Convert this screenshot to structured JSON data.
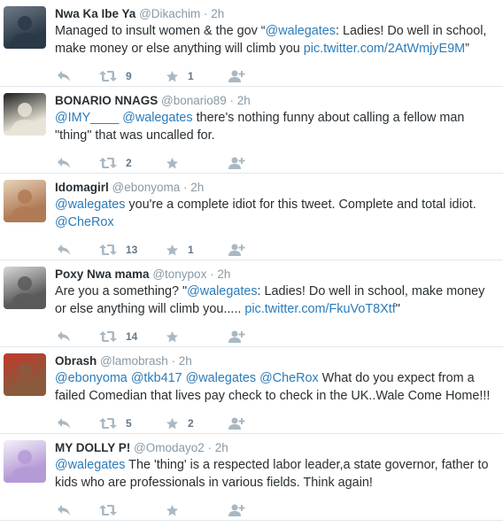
{
  "tweets": [
    {
      "fullname": "Nwa Ka Ibe Ya",
      "username": "@Dikachim",
      "time": "2h",
      "text": [
        {
          "t": "Managed to insult women & the gov “",
          "k": "p"
        },
        {
          "t": "@walegates",
          "k": "m"
        },
        {
          "t": ": Ladies! Do well in school, make money or else anything will climb you ",
          "k": "p"
        },
        {
          "t": "pic.twitter.com/2AtWmjyE9M",
          "k": "l"
        },
        {
          "t": "”",
          "k": "p"
        }
      ],
      "retweets": "9",
      "favorites": "1",
      "avatar_colors": [
        "#2b3a48",
        "#6d7a85"
      ]
    },
    {
      "fullname": "BONARIO NNAGS",
      "username": "@bonario89",
      "time": "2h",
      "text": [
        {
          "t": "@IMY____",
          "k": "m"
        },
        {
          "t": " ",
          "k": "p"
        },
        {
          "t": "@walegates",
          "k": "m"
        },
        {
          "t": " there's nothing funny about calling a fellow man \"thing\" that was uncalled for.",
          "k": "p"
        }
      ],
      "retweets": "2",
      "favorites": "",
      "avatar_colors": [
        "#e9e4d8",
        "#1c1c1c"
      ]
    },
    {
      "fullname": "Idomagirl",
      "username": "@ebonyoma",
      "time": "2h",
      "text": [
        {
          "t": "@walegates",
          "k": "m"
        },
        {
          "t": " you're a complete idiot for this tweet. Complete and total idiot. ",
          "k": "p"
        },
        {
          "t": "@CheRox",
          "k": "m"
        }
      ],
      "retweets": "13",
      "favorites": "1",
      "avatar_colors": [
        "#b07a56",
        "#e6d2b8"
      ]
    },
    {
      "fullname": "Poxy Nwa mama",
      "username": "@tonypox",
      "time": "2h",
      "text": [
        {
          "t": "Are you a something? \"",
          "k": "p"
        },
        {
          "t": "@walegates",
          "k": "m"
        },
        {
          "t": ": Ladies! Do well in school, make money or else anything will climb you..... ",
          "k": "p"
        },
        {
          "t": "pic.twitter.com/FkuVoT8Xtf",
          "k": "l"
        },
        {
          "t": "\"",
          "k": "p"
        }
      ],
      "retweets": "14",
      "favorites": "",
      "avatar_colors": [
        "#5a5a5a",
        "#d8d8d8"
      ]
    },
    {
      "fullname": "Obrash",
      "username": "@lamobrash",
      "time": "2h",
      "text": [
        {
          "t": "@ebonyoma",
          "k": "m"
        },
        {
          "t": " ",
          "k": "p"
        },
        {
          "t": "@tkb417",
          "k": "m"
        },
        {
          "t": " ",
          "k": "p"
        },
        {
          "t": "@walegates",
          "k": "m"
        },
        {
          "t": " ",
          "k": "p"
        },
        {
          "t": "@CheRox",
          "k": "m"
        },
        {
          "t": "  What do you expect from a failed Comedian that lives pay check to check in the UK..Wale Come Home!!!",
          "k": "p"
        }
      ],
      "retweets": "5",
      "favorites": "2",
      "avatar_colors": [
        "#8a5a3c",
        "#c0392b"
      ]
    },
    {
      "fullname": "MY DOLLY P!",
      "username": "@Omodayo2",
      "time": "2h",
      "text": [
        {
          "t": "@walegates",
          "k": "m"
        },
        {
          "t": "  The 'thing' is a respected labor leader,a state governor, father to kids who are professionals in various fields. Think again!",
          "k": "p"
        }
      ],
      "retweets": "",
      "favorites": "",
      "avatar_colors": [
        "#b49ad6",
        "#f4f0f8"
      ]
    }
  ]
}
